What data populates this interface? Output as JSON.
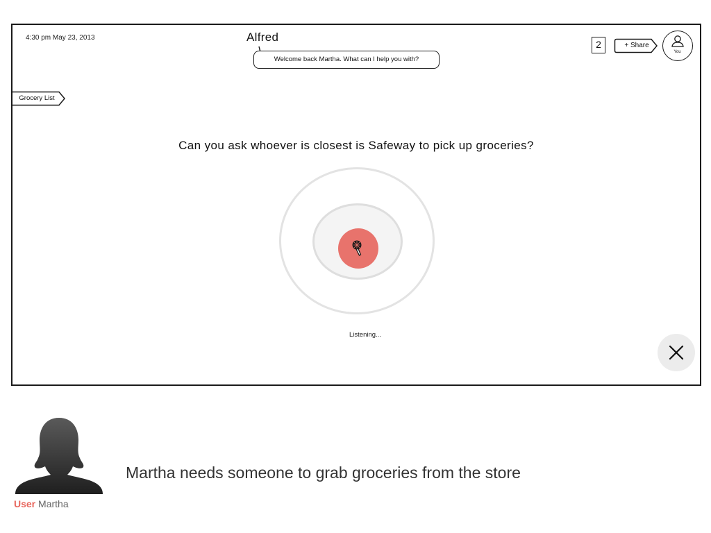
{
  "device": {
    "timestamp": "4:30 pm May 23, 2013",
    "assistant": {
      "name": "Alfred",
      "greeting": "Welcome back Martha. What can I help you with?"
    },
    "header": {
      "notification_count": "2",
      "share_label": "+ Share",
      "user_label": "You"
    },
    "list_tag": "Grocery List",
    "voice_query": "Can you ask whoever is closest is Safeway to pick up groceries?",
    "status": "Listening...",
    "close_label": "X",
    "colors": {
      "mic_accent": "#e8736c",
      "ring": "#e3e3e3",
      "close_bg": "#ececec"
    }
  },
  "persona": {
    "role": "User",
    "name": "Martha",
    "scenario": "Martha needs someone to grab groceries from the store",
    "colors": {
      "role": "#e8675e"
    }
  }
}
